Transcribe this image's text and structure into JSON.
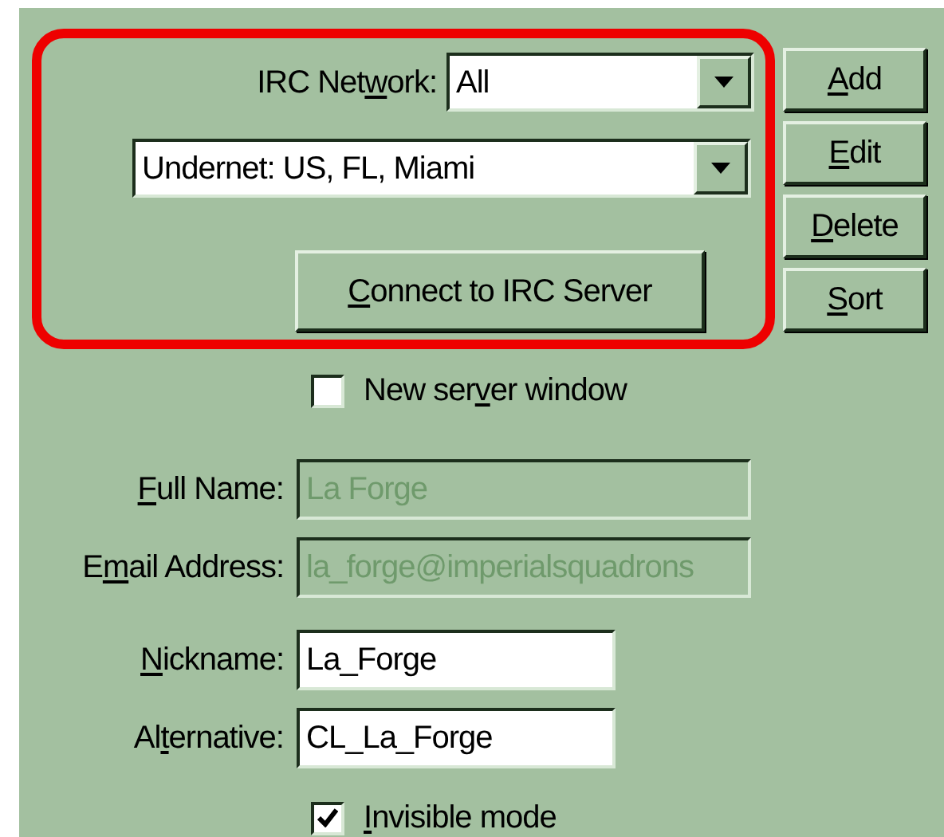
{
  "server_group": {
    "network_label": {
      "before": "IRC Net",
      "key": "w",
      "after": "ork:"
    },
    "network_combo": {
      "value": "All"
    },
    "server_combo": {
      "value": "Undernet: US, FL, Miami"
    },
    "connect_button": {
      "key": "C",
      "after": "onnect to IRC Server"
    }
  },
  "side_buttons": [
    {
      "key": "A",
      "after": "dd"
    },
    {
      "key": "E",
      "after": "dit"
    },
    {
      "key": "D",
      "after": "elete"
    },
    {
      "key": "S",
      "after": "ort"
    }
  ],
  "new_server_window": {
    "label": {
      "before": "New ser",
      "key": "v",
      "after": "er window"
    },
    "checked": false
  },
  "fields": [
    {
      "label": {
        "key": "F",
        "after": "ull Name:"
      },
      "value": "La Forge",
      "disabled": true
    },
    {
      "label": {
        "before": "E",
        "key": "m",
        "after": "ail Address:"
      },
      "value": "la_forge@imperialsquadrons",
      "disabled": true
    },
    {
      "label": {
        "key": "N",
        "after": "ickname:"
      },
      "value": "La_Forge",
      "disabled": false
    },
    {
      "label": {
        "before": "Al",
        "key": "t",
        "after": "ernative:"
      },
      "value": "CL_La_Forge",
      "disabled": false
    }
  ],
  "invisible_mode": {
    "label": {
      "key": "I",
      "after": "nvisible mode"
    },
    "checked": true
  }
}
